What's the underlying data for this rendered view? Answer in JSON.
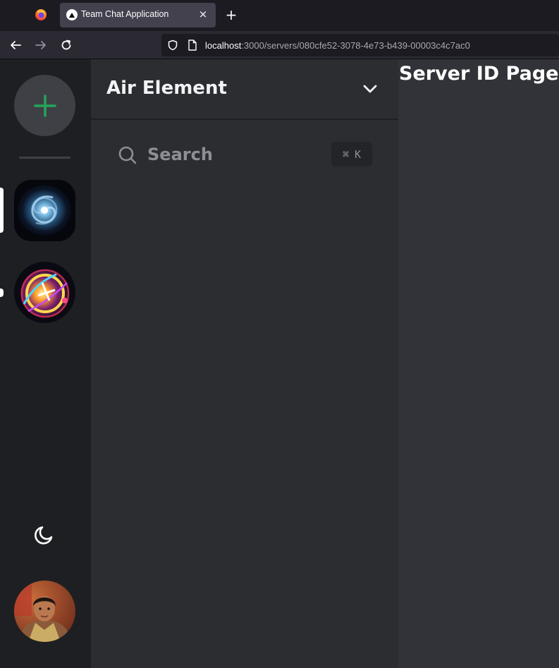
{
  "browser": {
    "tab": {
      "title": "Team Chat Application",
      "close_glyph": "×"
    },
    "new_tab_glyph": "+",
    "url": {
      "host": "localhost",
      "path": ":3000/servers/080cfe52-3078-4e73-b439-00003c4c7ac0"
    },
    "icons": [
      "firefox-icon",
      "back-arrow-icon",
      "forward-arrow-icon",
      "reload-icon",
      "shield-icon",
      "page-icon"
    ]
  },
  "server_rail": {
    "add_server": {
      "icon": "plus-icon",
      "color": "#23a55a"
    },
    "servers": [
      {
        "name": "galaxy-server",
        "active": true
      },
      {
        "name": "air-element-art-server",
        "active": false,
        "unread": true
      }
    ],
    "theme_toggle_icon": "moon-icon",
    "user_avatar": "user-avatar"
  },
  "channel_sidebar": {
    "server_name": "Air Element",
    "menu_icon": "chevron-down-icon",
    "search": {
      "label": "Search",
      "shortcut_symbol": "⌘",
      "shortcut_key": "K"
    }
  },
  "main": {
    "heading": "Server ID Page"
  },
  "colors": {
    "rail_bg": "#1e1f22",
    "sidebar_bg": "#2b2d31",
    "main_bg": "#313338",
    "accent_green": "#23a55a"
  }
}
